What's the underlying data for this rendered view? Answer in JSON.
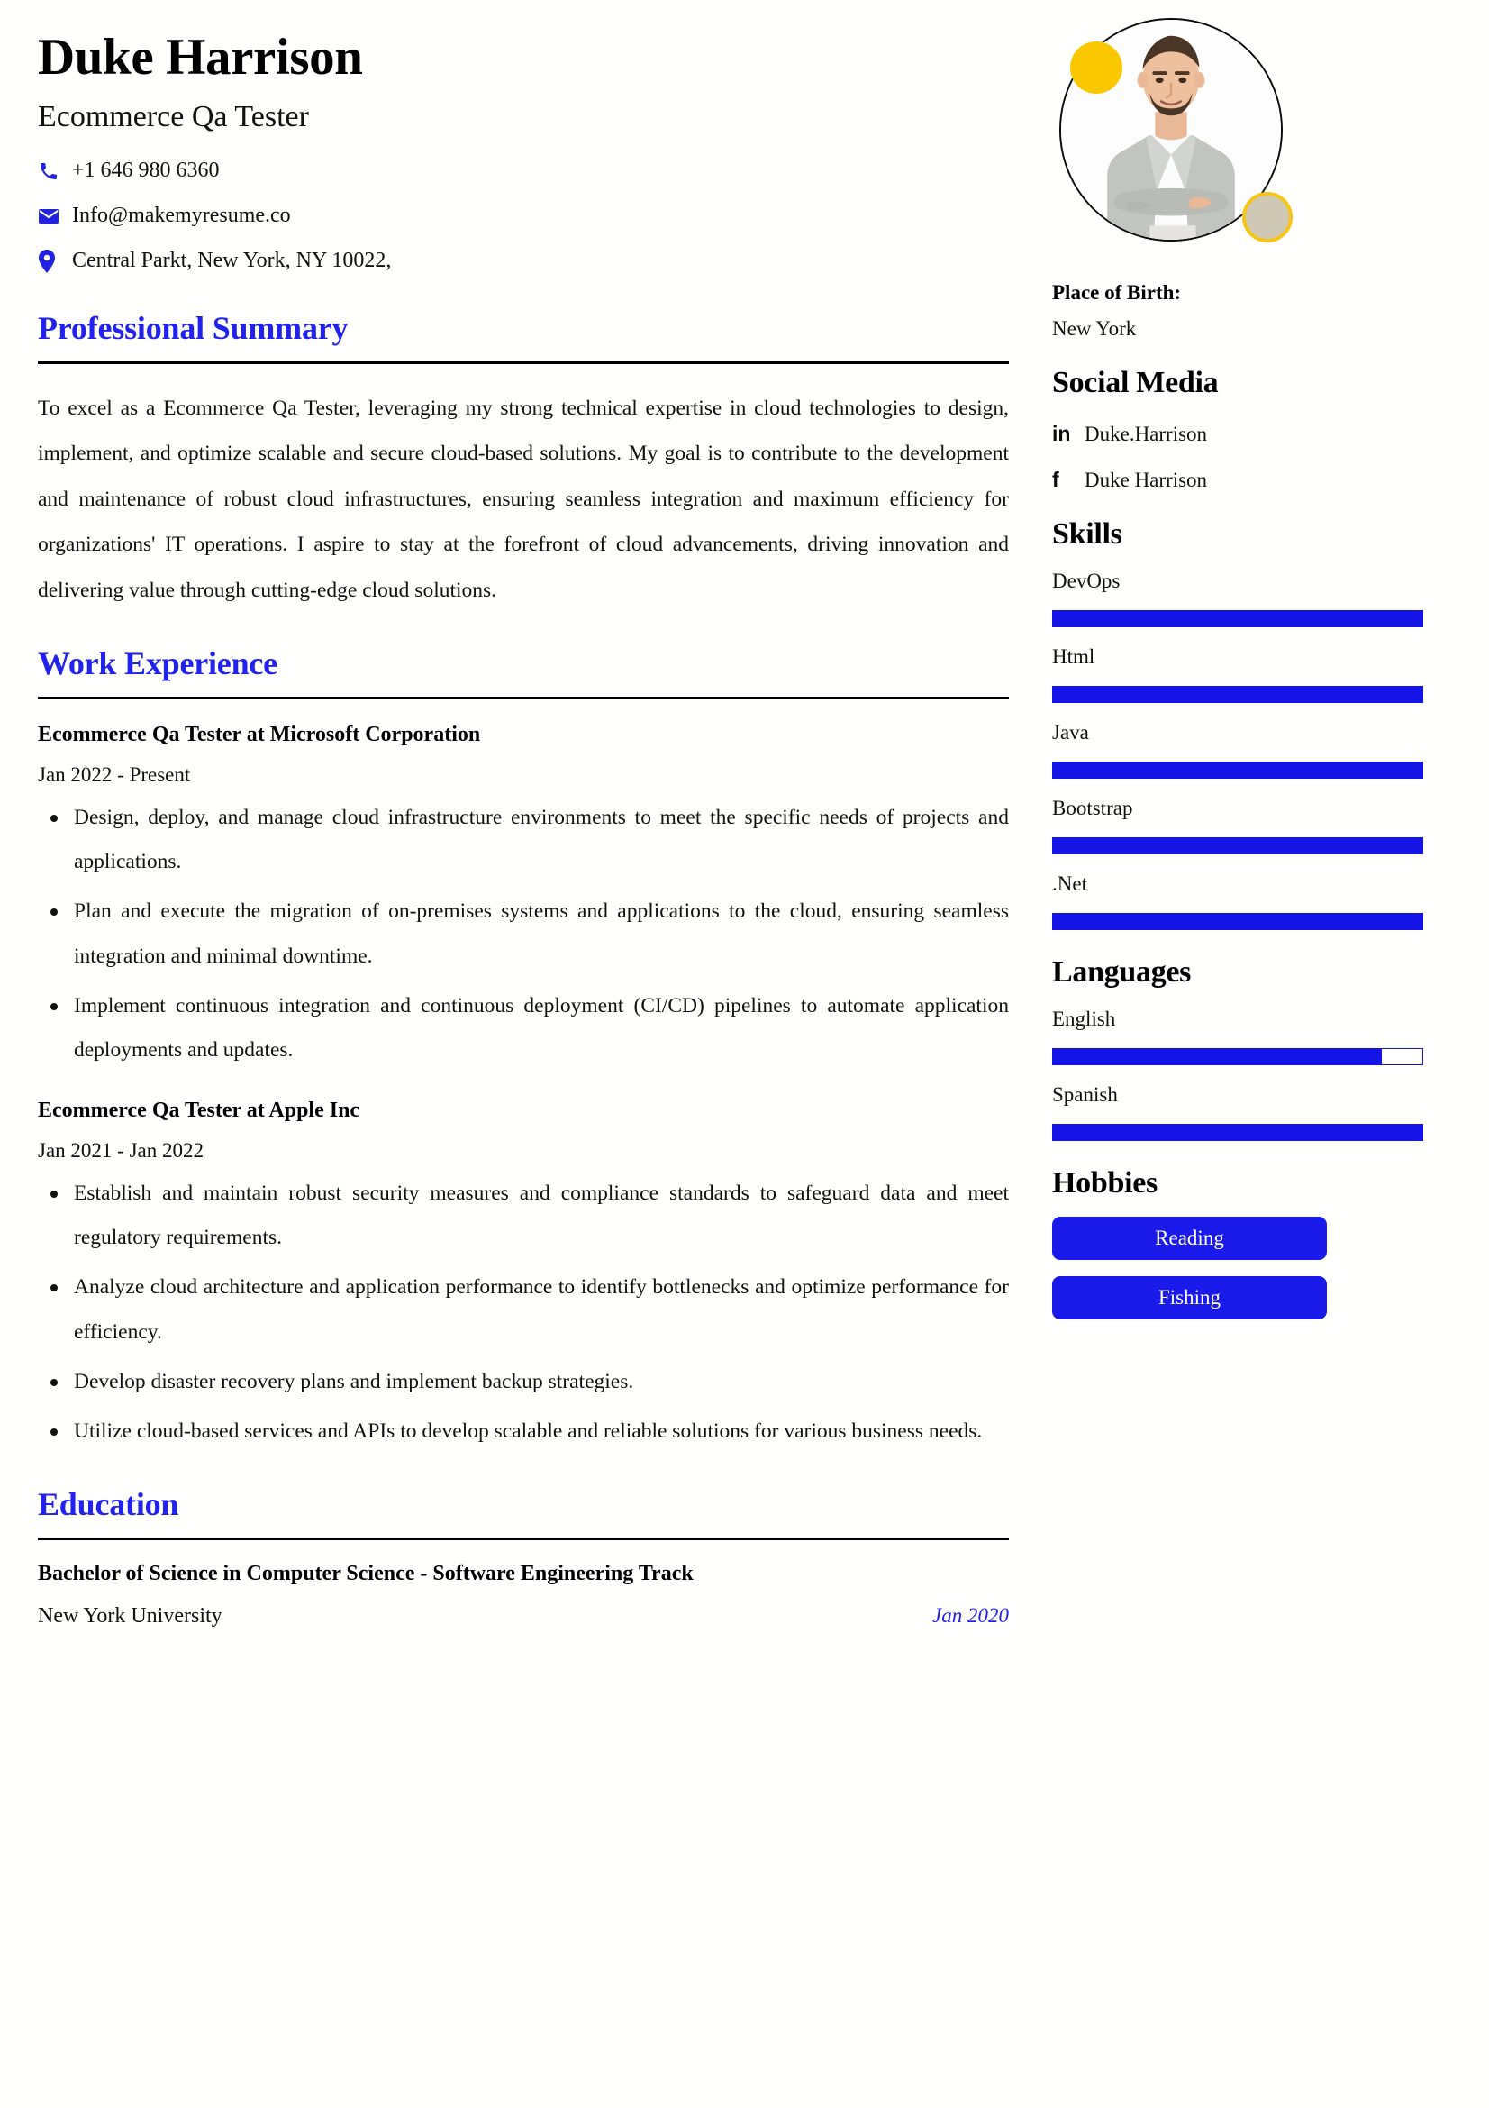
{
  "header": {
    "full_name": "Duke Harrison",
    "job_title": "Ecommerce Qa Tester",
    "contacts": [
      {
        "icon": "phone-icon",
        "text": "+1 646 980 6360"
      },
      {
        "icon": "envelope-icon",
        "text": "Info@makemyresume.co"
      },
      {
        "icon": "location-pin-icon",
        "text": "Central Parkt, New York, NY 10022,"
      }
    ]
  },
  "sections": {
    "summary_heading": "Professional Summary",
    "summary_text": "To excel as a Ecommerce Qa Tester, leveraging my strong technical expertise in cloud technologies to design, implement, and optimize scalable and secure cloud-based solutions. My goal is to contribute to the development and maintenance of robust cloud infrastructures, ensuring seamless integration and maximum efficiency for organizations' IT operations. I aspire to stay at the forefront of cloud advancements, driving innovation and delivering value through cutting-edge cloud solutions.",
    "work_heading": "Work Experience",
    "education_heading": "Education"
  },
  "experience": [
    {
      "title": "Ecommerce Qa Tester at Microsoft Corporation",
      "dates": "Jan 2022 - Present",
      "bullets": [
        "Design, deploy, and manage cloud infrastructure environments to meet the specific needs of projects and applications.",
        "Plan and execute the migration of on-premises systems and applications to the cloud, ensuring seamless integration and minimal downtime.",
        "Implement continuous integration and continuous deployment (CI/CD) pipelines to automate application deployments and updates."
      ]
    },
    {
      "title": "Ecommerce Qa Tester at Apple Inc",
      "dates": "Jan 2021 - Jan 2022",
      "bullets": [
        "Establish and maintain robust security measures and compliance standards to safeguard data and meet regulatory requirements.",
        "Analyze cloud architecture and application performance to identify bottlenecks and optimize performance for efficiency.",
        "Develop disaster recovery plans and implement backup strategies.",
        "Utilize cloud-based services and APIs to develop scalable and reliable solutions for various business needs."
      ]
    }
  ],
  "education": [
    {
      "degree": "Bachelor of Science in Computer Science - Software Engineering Track",
      "school": "New York University",
      "date": "Jan 2020"
    }
  ],
  "sidebar": {
    "place_of_birth_label": "Place of Birth:",
    "place_of_birth_value": "New York",
    "social_heading": "Social Media",
    "social": [
      {
        "icon": "linkedin-icon",
        "glyph": "in",
        "name": "Duke.Harrison"
      },
      {
        "icon": "facebook-icon",
        "glyph": "f",
        "name": "Duke Harrison"
      }
    ],
    "skills_heading": "Skills",
    "skills": [
      {
        "name": "DevOps",
        "level": 100
      },
      {
        "name": "Html",
        "level": 100
      },
      {
        "name": "Java",
        "level": 100
      },
      {
        "name": "Bootstrap",
        "level": 100
      },
      {
        "name": ".Net",
        "level": 100
      }
    ],
    "languages_heading": "Languages",
    "languages": [
      {
        "name": "English",
        "level": 89
      },
      {
        "name": "Spanish",
        "level": 100
      }
    ],
    "hobbies_heading": "Hobbies",
    "hobbies": [
      "Reading",
      "Fishing"
    ]
  },
  "colors": {
    "accent_blue": "#2222ee",
    "bar_blue": "#1414e6",
    "yellow_dot": "#fbc800",
    "beige_dot": "#cfc8b4",
    "rule_black": "#000000"
  }
}
